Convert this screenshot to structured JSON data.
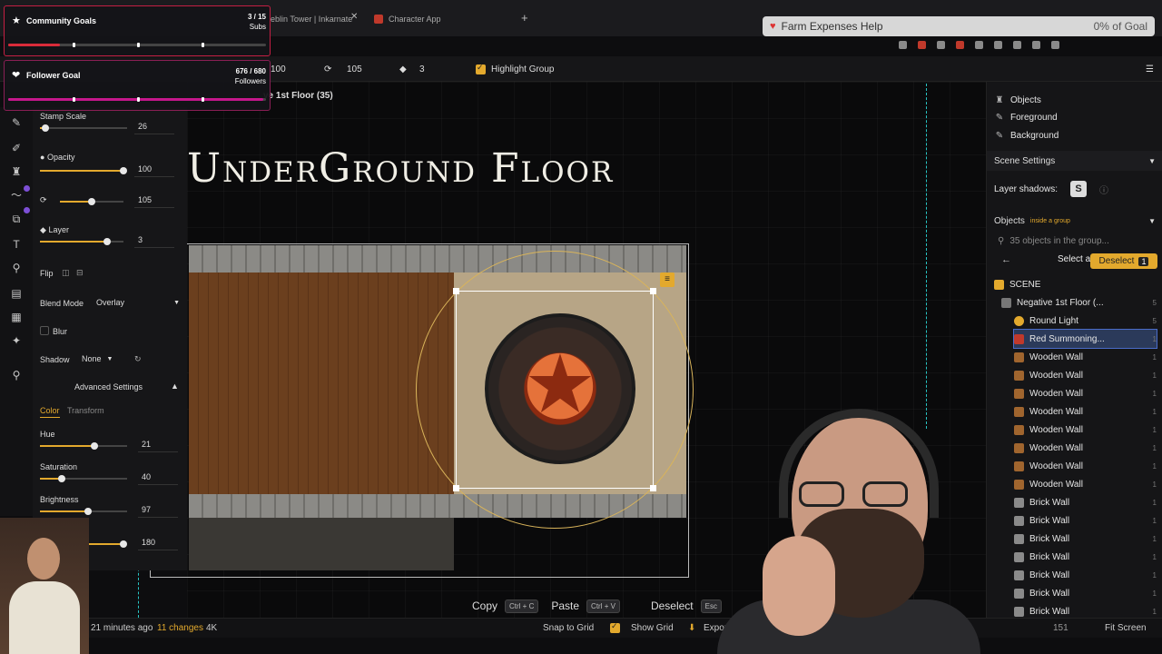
{
  "browser": {
    "tabs": [
      {
        "title": "eblin Tower | Inkarnate"
      },
      {
        "title": "Character App"
      }
    ],
    "goal_bar": {
      "label": "Farm Expenses Help",
      "percent_text": "0% of Goal"
    }
  },
  "overlays": {
    "community_goals": {
      "title": "Community Goals",
      "count": "3 / 15",
      "unit": "Subs",
      "fill_fraction": 0.2
    },
    "follower_goal": {
      "title": "Follower Goal",
      "count": "676 / 680",
      "unit": "Followers",
      "fill_fraction": 0.99
    }
  },
  "toolbar": {
    "field1": "100",
    "field2": "105",
    "field3": "3",
    "highlight_group": "Highlight Group",
    "floor_label": "ve 1st Floor (35)"
  },
  "props": {
    "stamp_scale": {
      "label": "Stamp Scale",
      "value": "26",
      "fraction": 0.06
    },
    "opacity": {
      "label": "Opacity",
      "value": "100",
      "fraction": 1.0
    },
    "rotation": {
      "value": "105",
      "fraction": 0.5
    },
    "layer": {
      "label": "Layer",
      "value": "3",
      "fraction": 0.8
    },
    "flip": {
      "label": "Flip"
    },
    "blend_mode": {
      "label": "Blend Mode",
      "value": "Overlay"
    },
    "blur": {
      "label": "Blur"
    },
    "shadow": {
      "label": "Shadow",
      "value": "None"
    },
    "advanced": {
      "label": "Advanced Settings"
    },
    "tabs": {
      "color": "Color",
      "transform": "Transform"
    },
    "hue": {
      "label": "Hue",
      "value": "21",
      "fraction": 0.62
    },
    "saturation": {
      "label": "Saturation",
      "value": "40",
      "fraction": 0.25
    },
    "brightness": {
      "label": "Brightness",
      "value": "97",
      "fraction": 0.55
    },
    "extra": {
      "value": "180",
      "fraction": 0.95
    }
  },
  "canvas": {
    "map_title": "UnderGround Floor"
  },
  "actions": {
    "copy": "Copy",
    "copy_key": "Ctrl + C",
    "paste": "Paste",
    "paste_key": "Ctrl + V",
    "deselect": "Deselect",
    "deselect_key": "Esc"
  },
  "status": {
    "saved": "21 minutes ago",
    "changes": "11 changes",
    "resolution": "4K",
    "snap": "Snap to Grid",
    "show_grid": "Show Grid",
    "export": "Expor",
    "count": "151",
    "fit": "Fit Screen"
  },
  "right_panel": {
    "layers": [
      {
        "label": "Objects"
      },
      {
        "label": "Foreground"
      },
      {
        "label": "Background"
      }
    ],
    "scene_settings": "Scene Settings",
    "layer_shadows": "Layer shadows:",
    "shadow_toggle": "S",
    "objects": "Objects",
    "inside_group": "inside a group",
    "search_placeholder": "35 objects in the group...",
    "select_all": "Select all",
    "deselect": "Deselect",
    "deselect_count": "1",
    "scene": "SCENE",
    "tree": [
      {
        "label": "Negative 1st Floor (..."
      },
      {
        "label": "Round Light"
      },
      {
        "label": "Red Summoning..."
      },
      {
        "label": "Wooden Wall"
      },
      {
        "label": "Wooden Wall"
      },
      {
        "label": "Wooden Wall"
      },
      {
        "label": "Wooden Wall"
      },
      {
        "label": "Wooden Wall"
      },
      {
        "label": "Wooden Wall"
      },
      {
        "label": "Wooden Wall"
      },
      {
        "label": "Wooden Wall"
      },
      {
        "label": "Brick Wall"
      },
      {
        "label": "Brick Wall"
      },
      {
        "label": "Brick Wall"
      },
      {
        "label": "Brick Wall"
      },
      {
        "label": "Brick Wall"
      },
      {
        "label": "Brick Wall"
      },
      {
        "label": "Brick Wall"
      }
    ],
    "lock_counts": [
      "5",
      "5",
      "1",
      "1",
      "1",
      "1",
      "1",
      "1",
      "1",
      "1",
      "1",
      "1",
      "1",
      "1",
      "1",
      "1",
      "1",
      "1"
    ]
  },
  "colors": {
    "accent": "#e3a92d",
    "selection": "#4a6cc9",
    "goal_red": "#d92b3a",
    "goal_pink": "#c5178c"
  }
}
